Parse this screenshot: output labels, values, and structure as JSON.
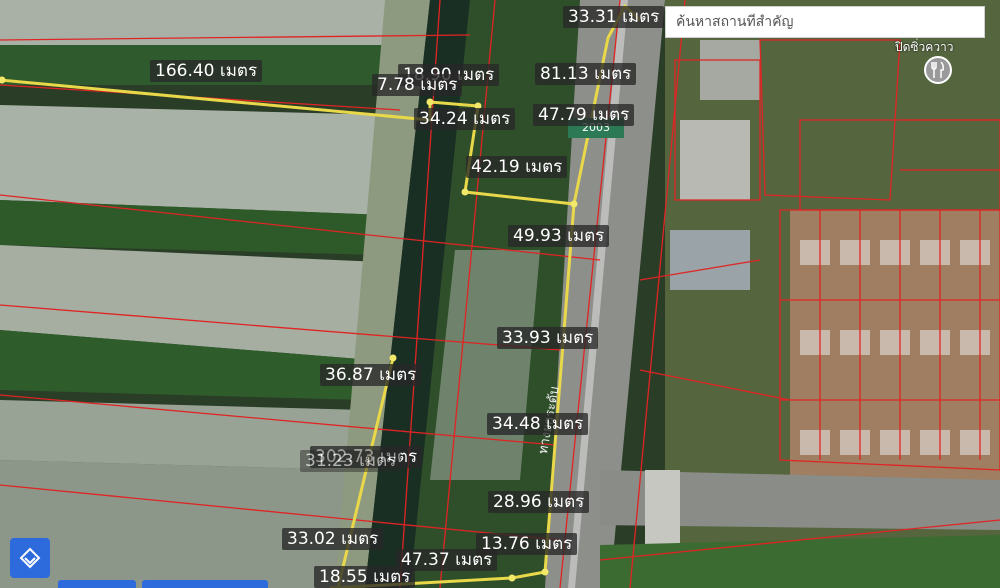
{
  "search": {
    "placeholder": "ค้นหาสถานที่สำคัญ"
  },
  "poi": {
    "label": "ปิดซิ่วควาว",
    "icon": "restaurant-icon"
  },
  "road": {
    "sign": "2003",
    "text": "ทางยกระดับ"
  },
  "measurements": [
    {
      "id": "m01",
      "text": "33.31 เมตร"
    },
    {
      "id": "m02",
      "text": "166.40 เมตร"
    },
    {
      "id": "m03",
      "text": "18.90 เมตร"
    },
    {
      "id": "m04",
      "text": "7.78 เมตร"
    },
    {
      "id": "m05",
      "text": "81.13 เมตร"
    },
    {
      "id": "m06",
      "text": "34.24 เมตร"
    },
    {
      "id": "m07",
      "text": "47.79 เมตร"
    },
    {
      "id": "m08",
      "text": "42.19 เมตร"
    },
    {
      "id": "m09",
      "text": "49.93 เมตร"
    },
    {
      "id": "m10",
      "text": "33.93 เมตร"
    },
    {
      "id": "m11",
      "text": "36.87 เมตร"
    },
    {
      "id": "m12",
      "text": "34.48 เมตร"
    },
    {
      "id": "m13",
      "text": "302.73 เมตร"
    },
    {
      "id": "m14",
      "text": "31.23 เมตร"
    },
    {
      "id": "m15",
      "text": "28.96 เมตร"
    },
    {
      "id": "m16",
      "text": "33.02 เมตร"
    },
    {
      "id": "m17",
      "text": "13.76 เมตร"
    },
    {
      "id": "m18",
      "text": "47.37 เมตร"
    },
    {
      "id": "m19",
      "text": "18.55 เมตร"
    }
  ],
  "colors": {
    "measure_line": "#e8d84a",
    "parcel_line": "#e02424",
    "water": "#1f3326",
    "fish_pond": "#c9cfc7",
    "vegetation": "#2e5a2a",
    "road": "#8d8f8a",
    "accent": "#2d6bdc"
  },
  "controls": {
    "layer_icon": "layers-icon"
  }
}
